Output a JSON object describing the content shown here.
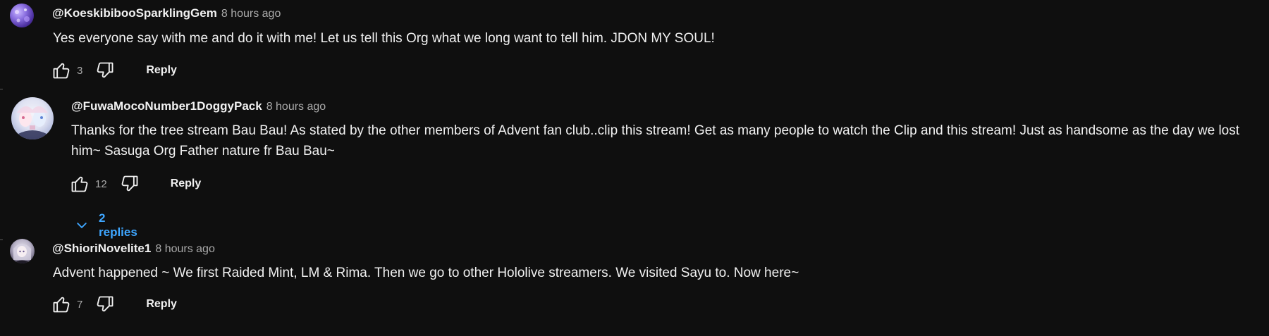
{
  "colors": {
    "background": "#0f0f0f",
    "text": "#f1f1f1",
    "muted": "#aaaaaa",
    "link": "#3ea6ff"
  },
  "comments": [
    {
      "author": "@KoeskibibooSparklingGem",
      "time": "8 hours ago",
      "text": "Yes everyone say with me and do it with me! Let us tell this Org what we long want to tell him. JDON MY SOUL!",
      "likes": "3",
      "like_icon": "thumbs-up-icon",
      "dislike_icon": "thumbs-down-icon",
      "reply_label": "Reply"
    },
    {
      "author": "@FuwaMocoNumber1DoggyPack",
      "time": "8 hours ago",
      "text": "Thanks for the tree stream Bau Bau! As stated by the other members of Advent fan club..clip this stream! Get as many people to watch the Clip and this stream! Just as handsome as the day we lost him~ Sasuga Org Father nature fr Bau Bau~",
      "likes": "12",
      "like_icon": "thumbs-up-icon",
      "dislike_icon": "thumbs-down-icon",
      "reply_label": "Reply",
      "replies_label": "2 replies",
      "replies_icon": "chevron-down-icon"
    },
    {
      "author": "@ShioriNovelite1",
      "time": "8 hours ago",
      "text": "Advent happened ~ We first Raided Mint, LM & Rima. Then we go to other Hololive streamers. We visited Sayu to. Now here~",
      "likes": "7",
      "like_icon": "thumbs-up-icon",
      "dislike_icon": "thumbs-down-icon",
      "reply_label": "Reply"
    }
  ]
}
